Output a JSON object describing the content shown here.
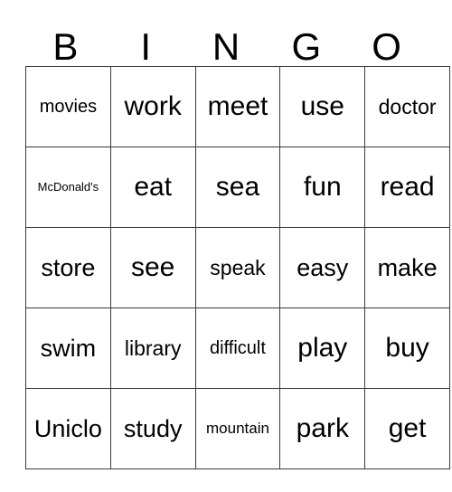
{
  "card": {
    "header": {
      "letters": [
        "B",
        "I",
        "N",
        "G",
        "O"
      ]
    },
    "rows": [
      [
        {
          "text": "movies",
          "size": "fs-sm"
        },
        {
          "text": "work",
          "size": "fs-xl"
        },
        {
          "text": "meet",
          "size": "fs-xl"
        },
        {
          "text": "use",
          "size": "fs-xl"
        },
        {
          "text": "doctor",
          "size": "fs-md"
        }
      ],
      [
        {
          "text": "McDonald's",
          "size": "fs-xxs"
        },
        {
          "text": "eat",
          "size": "fs-xl"
        },
        {
          "text": "sea",
          "size": "fs-xl"
        },
        {
          "text": "fun",
          "size": "fs-xl"
        },
        {
          "text": "read",
          "size": "fs-xl"
        }
      ],
      [
        {
          "text": "store",
          "size": "fs-lg"
        },
        {
          "text": "see",
          "size": "fs-xl"
        },
        {
          "text": "speak",
          "size": "fs-md"
        },
        {
          "text": "easy",
          "size": "fs-lg"
        },
        {
          "text": "make",
          "size": "fs-lg"
        }
      ],
      [
        {
          "text": "swim",
          "size": "fs-lg"
        },
        {
          "text": "library",
          "size": "fs-md"
        },
        {
          "text": "difficult",
          "size": "fs-sm"
        },
        {
          "text": "play",
          "size": "fs-xl"
        },
        {
          "text": "buy",
          "size": "fs-xl"
        }
      ],
      [
        {
          "text": "Uniclo",
          "size": "fs-lg"
        },
        {
          "text": "study",
          "size": "fs-lg"
        },
        {
          "text": "mountain",
          "size": "fs-xs"
        },
        {
          "text": "park",
          "size": "fs-xl"
        },
        {
          "text": "get",
          "size": "fs-xl"
        }
      ]
    ]
  }
}
